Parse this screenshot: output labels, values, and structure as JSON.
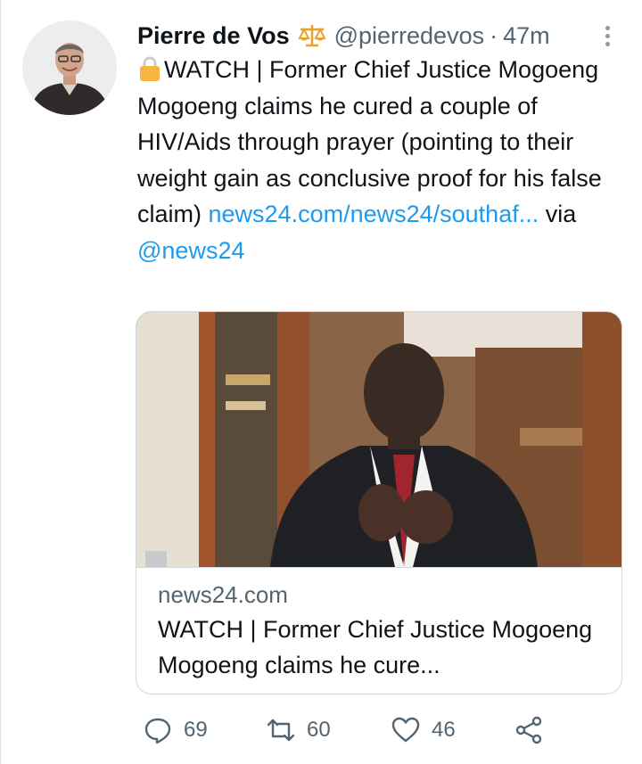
{
  "tweet": {
    "display_name": "Pierre de Vos",
    "verified_badge": "scales-of-justice-icon",
    "handle": "@pierredevos",
    "separator": "·",
    "time": "47m",
    "text_part": "WATCH | Former Chief Justice Mogoeng Mogoeng claims he cured a couple of HIV/Aids through prayer (pointing to their weight gain as conclusive proof for his false claim)",
    "link_text": "news24.com/news24/southaf...",
    "via_text": " via ",
    "mention": "@news24"
  },
  "card": {
    "domain": "news24.com",
    "title": "WATCH | Former Chief Justice Mogoeng Mogoeng claims he cure..."
  },
  "actions": {
    "replies": "69",
    "retweets": "60",
    "likes": "46"
  },
  "colors": {
    "link": "#1d9bf0",
    "secondary_text": "#536471",
    "border": "#cfd9de"
  }
}
